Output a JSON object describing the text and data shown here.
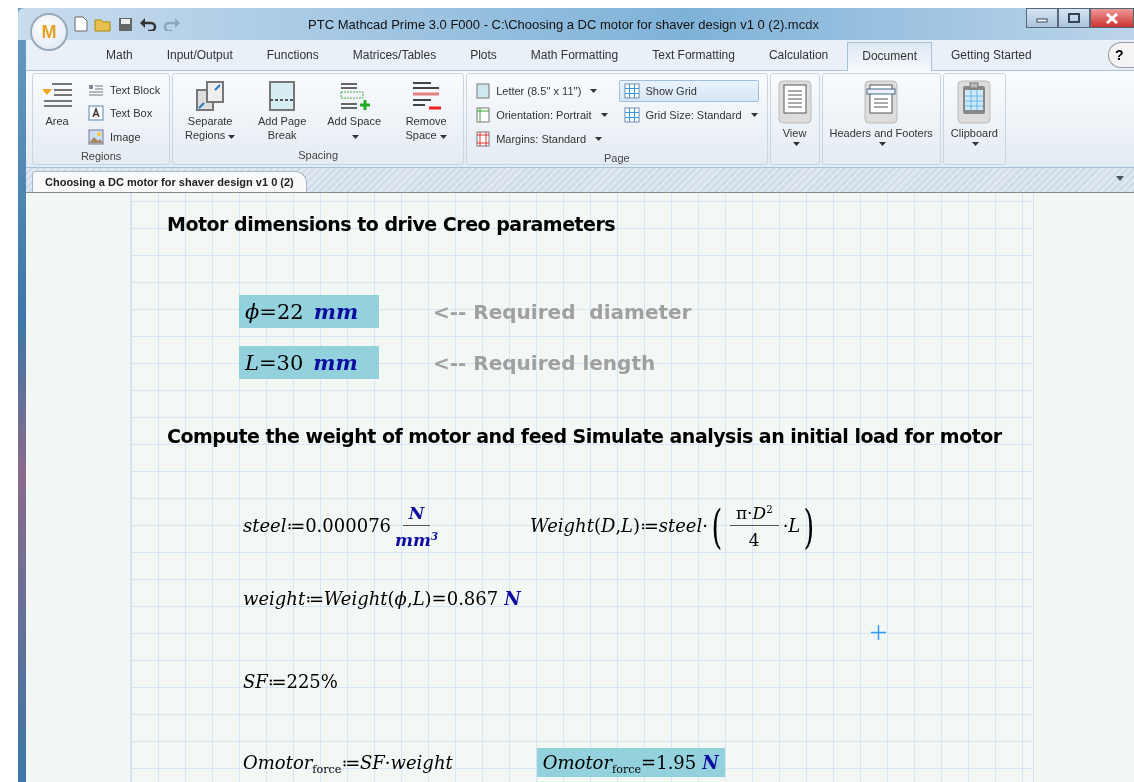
{
  "window": {
    "title": "PTC Mathcad Prime 3.0 F000 - C:\\Choosing a DC motor for shaver design v1 0 (2).mcdx",
    "app_badge": "M"
  },
  "ribbon_tabs": [
    {
      "label": "Math",
      "selected": false
    },
    {
      "label": "Input/Output",
      "selected": false
    },
    {
      "label": "Functions",
      "selected": false
    },
    {
      "label": "Matrices/Tables",
      "selected": false
    },
    {
      "label": "Plots",
      "selected": false
    },
    {
      "label": "Math Formatting",
      "selected": false
    },
    {
      "label": "Text Formatting",
      "selected": false
    },
    {
      "label": "Calculation",
      "selected": false
    },
    {
      "label": "Document",
      "selected": true
    },
    {
      "label": "Getting Started",
      "selected": false
    }
  ],
  "help_button": "?",
  "ribbon_groups": [
    {
      "label": "Regions",
      "kind": "regions",
      "items": [
        {
          "label": "Area"
        },
        {
          "label": "Text Block"
        },
        {
          "label": "Text Box"
        },
        {
          "label": "Image"
        }
      ]
    },
    {
      "label": "Spacing",
      "kind": "big",
      "items": [
        {
          "label": "Separate Regions",
          "dropdown": true
        },
        {
          "label": "Add Page Break",
          "dropdown": false
        },
        {
          "label": "Add Space",
          "dropdown": true
        },
        {
          "label": "Remove Space",
          "dropdown": true
        }
      ]
    },
    {
      "label": "Page",
      "kind": "page",
      "items": [
        {
          "label": "Letter (8.5'' x 11'')",
          "dropdown": true,
          "checked": false
        },
        {
          "label": "Orientation:  Portrait",
          "dropdown": true,
          "checked": false
        },
        {
          "label": "Margins:  Standard",
          "dropdown": true,
          "checked": false
        },
        {
          "label": "Show Grid",
          "dropdown": false,
          "checked": true
        },
        {
          "label": "Grid Size:  Standard",
          "dropdown": true,
          "checked": false
        }
      ]
    },
    {
      "kind": "tall",
      "items": [
        {
          "label": "View",
          "dropdown": true
        }
      ]
    },
    {
      "kind": "tall",
      "items": [
        {
          "label": "Headers and Footers",
          "dropdown": true
        }
      ]
    },
    {
      "kind": "tall",
      "items": [
        {
          "label": "Clipboard",
          "dropdown": true
        }
      ]
    }
  ],
  "document_tab": {
    "label": "Choosing a DC motor for shaver design v1 0 (2)"
  },
  "worksheet": [
    {
      "kind": "heading",
      "text": "Motor dimensions to drive Creo parameters"
    },
    {
      "kind": "input",
      "expr": "*ϕ*=22",
      "unit": "mm",
      "highlighted": true,
      "comment": "<-- Required  diameter"
    },
    {
      "kind": "input",
      "expr": "*L*=30",
      "unit": "mm",
      "highlighted": true,
      "comment": "<-- Required length"
    },
    {
      "kind": "heading",
      "text": "Compute the weight of motor and feed Simulate analysis an initial load for motor"
    },
    {
      "kind": "definitions",
      "left": {
        "expr": "*steel*≔0.000076",
        "numerator": "N",
        "denominator": "mm$^{3}$"
      },
      "right": {
        "expr": "*Weight*(*D*,*L*)≔*steel*·",
        "open": "(",
        "numerator": "π·*D*$^{2}$",
        "denominator": "4",
        "tail": "·*L*",
        "close": ")"
      }
    },
    {
      "kind": "result",
      "expr": "*weight*≔*Weight*(*ϕ*,*L*)=0.867",
      "unit": "N",
      "highlighted": false
    },
    {
      "kind": "plain",
      "expr": "*SF*≔225%"
    },
    {
      "kind": "pair",
      "expr": "*Omotor*$_{force}$≔*SF*·*weight*",
      "result": {
        "expr": "*Omotor*$_{force}$=1.95",
        "unit": "N",
        "highlighted": true
      }
    }
  ]
}
